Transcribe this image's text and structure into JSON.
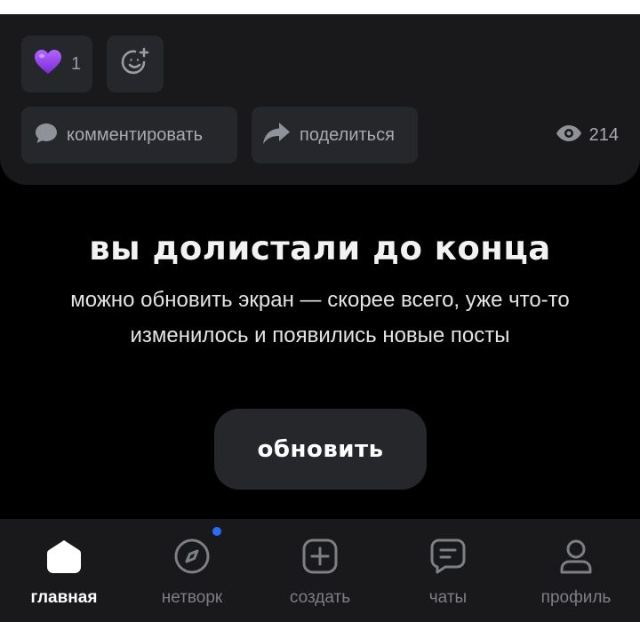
{
  "post": {
    "reaction_count": "1",
    "comment_label": "комментировать",
    "share_label": "поделиться",
    "views_count": "214"
  },
  "feed_end": {
    "title": "вы долистали до конца",
    "subtitle": "можно обновить экран — скорее всего, уже что-то изменилось и появились новые посты",
    "refresh_label": "обновить"
  },
  "tab_bar": {
    "tabs": [
      {
        "label": "главная",
        "icon": "home-icon",
        "active": true
      },
      {
        "label": "нетворк",
        "icon": "compass-icon",
        "active": false,
        "has_notification": true
      },
      {
        "label": "создать",
        "icon": "plus-square-icon",
        "active": false
      },
      {
        "label": "чаты",
        "icon": "chat-icon",
        "active": false
      },
      {
        "label": "профиль",
        "icon": "profile-icon",
        "active": false
      }
    ]
  },
  "colors": {
    "background": "#000000",
    "card": "#19191b",
    "chip": "#26272a",
    "reaction_heart": "#8f3cf0",
    "notification_dot": "#2a6cf6"
  }
}
